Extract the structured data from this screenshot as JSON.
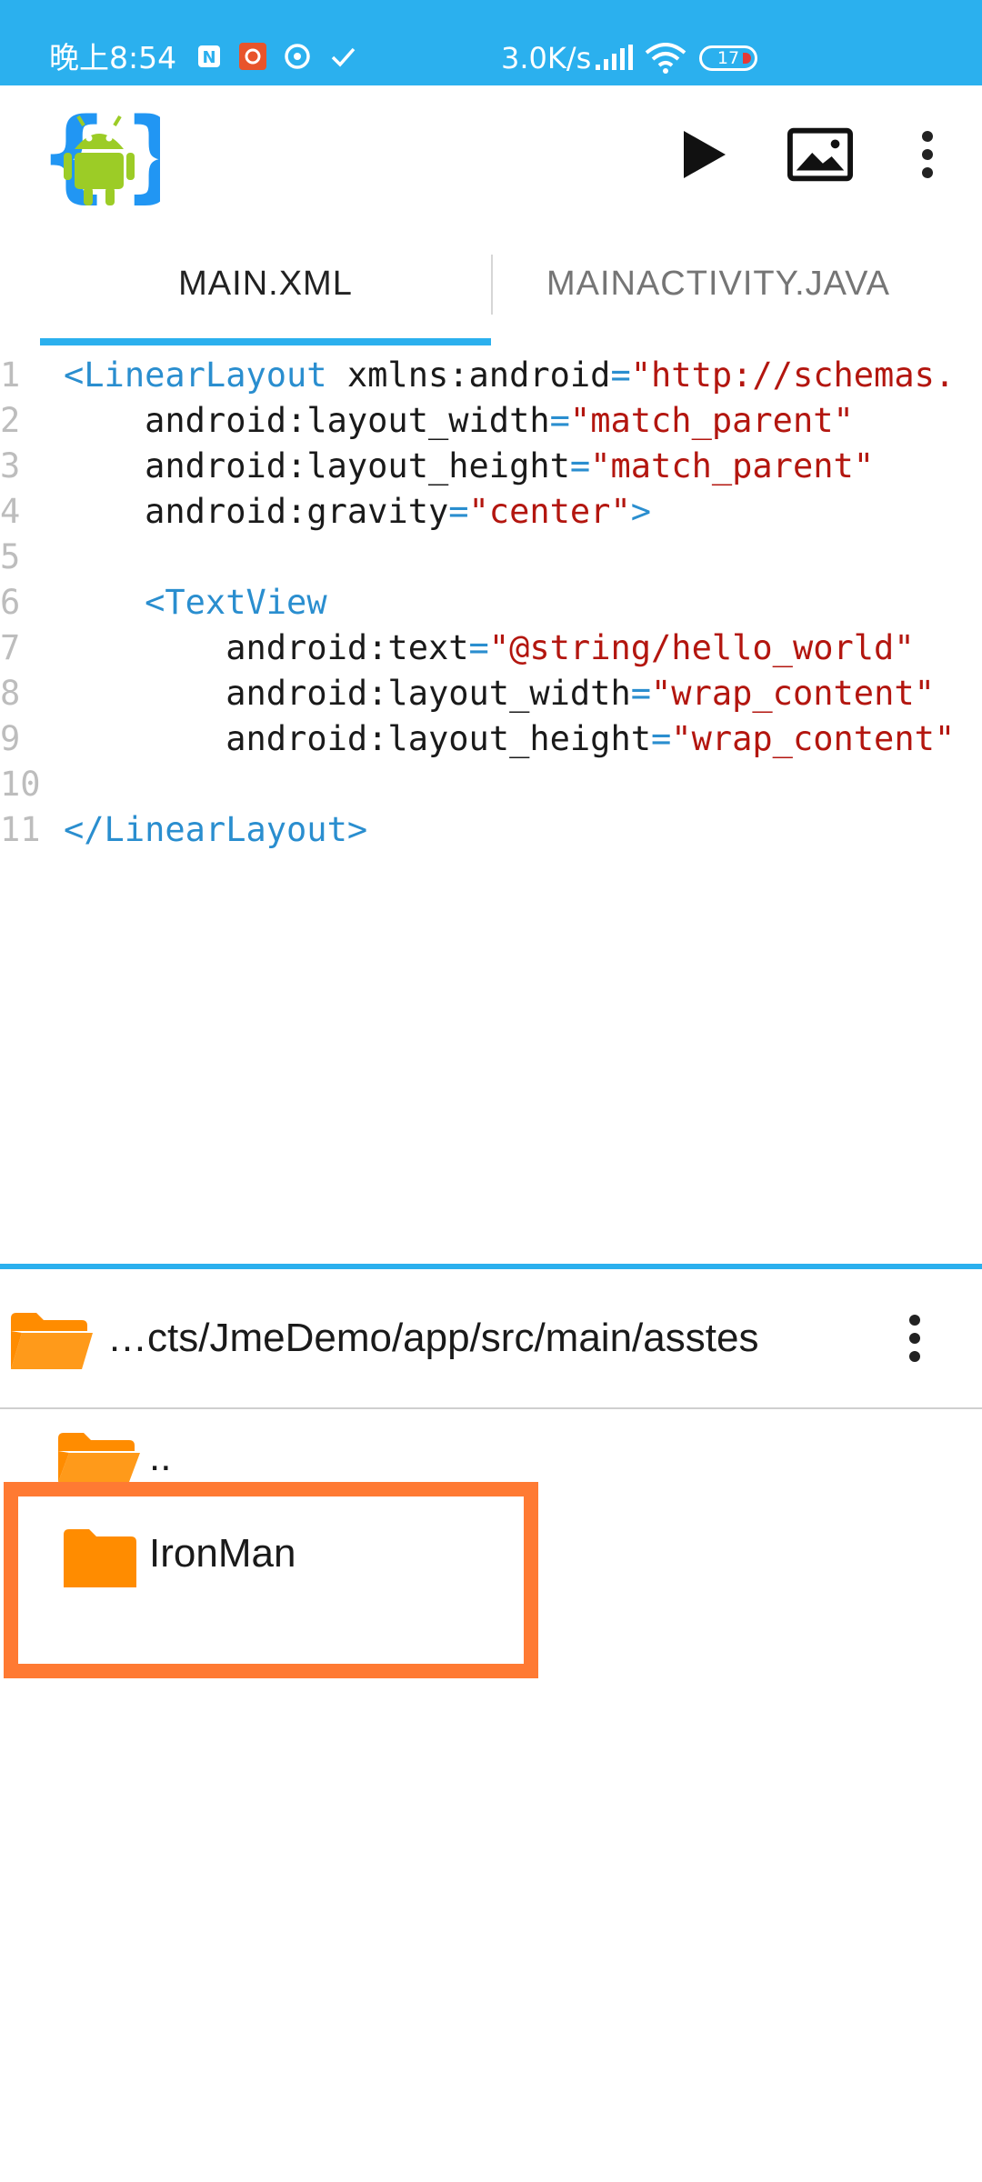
{
  "status_bar": {
    "time": "晚上8:54",
    "net_speed": "3.0K/s",
    "battery": "17",
    "notif_icons": [
      "notification-n-icon",
      "app-notification-icon",
      "sync-icon",
      "check-icon"
    ]
  },
  "toolbar": {
    "logo_icon": "android-logo-icon",
    "run_icon": "play-icon",
    "image_icon": "image-icon",
    "menu_icon": "more-vert-icon"
  },
  "tabs": [
    {
      "label": "MAIN.XML",
      "active": true
    },
    {
      "label": "MAINACTIVITY.JAVA",
      "active": false
    }
  ],
  "editor": {
    "lines": [
      {
        "no": "1",
        "indent": "",
        "parts": [
          [
            "tag",
            "<LinearLayout"
          ],
          [
            "attr",
            " xmlns:android"
          ],
          [
            "eq",
            "="
          ],
          [
            "str",
            "\"http://schemas."
          ]
        ]
      },
      {
        "no": "2",
        "indent": "    ",
        "parts": [
          [
            "attr",
            "android:layout_width"
          ],
          [
            "eq",
            "="
          ],
          [
            "str",
            "\"match_parent\""
          ]
        ]
      },
      {
        "no": "3",
        "indent": "    ",
        "parts": [
          [
            "attr",
            "android:layout_height"
          ],
          [
            "eq",
            "="
          ],
          [
            "str",
            "\"match_parent\""
          ]
        ]
      },
      {
        "no": "4",
        "indent": "    ",
        "parts": [
          [
            "attr",
            "android:gravity"
          ],
          [
            "eq",
            "="
          ],
          [
            "str",
            "\"center\""
          ],
          [
            "tag",
            ">"
          ]
        ]
      },
      {
        "no": "5",
        "indent": "",
        "parts": []
      },
      {
        "no": "6",
        "indent": "    ",
        "parts": [
          [
            "tag",
            "<TextView"
          ]
        ]
      },
      {
        "no": "7",
        "indent": "        ",
        "parts": [
          [
            "attr",
            "android:text"
          ],
          [
            "eq",
            "="
          ],
          [
            "str",
            "\"@string/hello_world\""
          ]
        ]
      },
      {
        "no": "8",
        "indent": "        ",
        "parts": [
          [
            "attr",
            "android:layout_width"
          ],
          [
            "eq",
            "="
          ],
          [
            "str",
            "\"wrap_content\""
          ]
        ]
      },
      {
        "no": "9",
        "indent": "        ",
        "parts": [
          [
            "attr",
            "android:layout_height"
          ],
          [
            "eq",
            "="
          ],
          [
            "str",
            "\"wrap_content\""
          ]
        ]
      },
      {
        "no": "10",
        "indent": "",
        "parts": []
      },
      {
        "no": "11",
        "indent": "",
        "parts": [
          [
            "tag",
            "</LinearLayout>"
          ]
        ]
      }
    ]
  },
  "browser": {
    "path": "…cts/JmeDemo/app/src/main/asstes",
    "items": [
      {
        "name": "..",
        "type": "folder-open"
      },
      {
        "name": "IronMan",
        "type": "folder"
      }
    ]
  },
  "colors": {
    "accent": "#2bb0ee",
    "folder": "#ff8c00",
    "highlight": "#ff7a33"
  }
}
